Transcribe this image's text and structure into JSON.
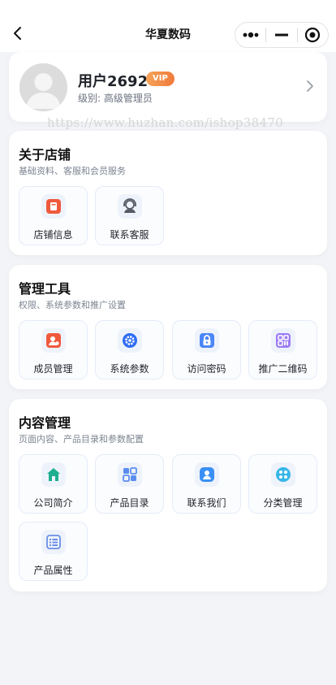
{
  "nav": {
    "title": "华夏数码"
  },
  "profile": {
    "name": "用户2692",
    "vip_label": "VIP",
    "level_text": "级别: 高级管理员"
  },
  "watermark": "https://www.huzhan.com/ishop38470",
  "sections": [
    {
      "title": "关于店铺",
      "subtitle": "基础资料、客服和会员服务",
      "items": [
        {
          "label": "店铺信息",
          "icon": "store-icon"
        },
        {
          "label": "联系客服",
          "icon": "headset-icon"
        }
      ]
    },
    {
      "title": "管理工具",
      "subtitle": "权限、系统参数和推广设置",
      "items": [
        {
          "label": "成员管理",
          "icon": "member-icon"
        },
        {
          "label": "系统参数",
          "icon": "gear-icon"
        },
        {
          "label": "访问密码",
          "icon": "lock-icon"
        },
        {
          "label": "推广二维码",
          "icon": "qr-code-icon"
        }
      ]
    },
    {
      "title": "内容管理",
      "subtitle": "页面内容、产品目录和参数配置",
      "items": [
        {
          "label": "公司简介",
          "icon": "home-icon"
        },
        {
          "label": "产品目录",
          "icon": "catalog-icon"
        },
        {
          "label": "联系我们",
          "icon": "contact-icon"
        },
        {
          "label": "分类管理",
          "icon": "category-icon"
        },
        {
          "label": "产品属性",
          "icon": "list-icon"
        }
      ]
    }
  ],
  "colors": {
    "background": "#f2f4f8",
    "vip_badge": "#f07a3a",
    "store_icon": "#ef5a3c",
    "member_icon": "#ef5a3c",
    "gear_icon": "#2f6df6",
    "lock_icon": "#4a86f7",
    "qr_icon": "#9b7cf5",
    "home_icon": "#1fae8f",
    "catalog_icon": "#5b8def",
    "contact_icon": "#3a8ff5",
    "category_icon": "#38b6e8",
    "list_icon": "#6b8fe8"
  }
}
